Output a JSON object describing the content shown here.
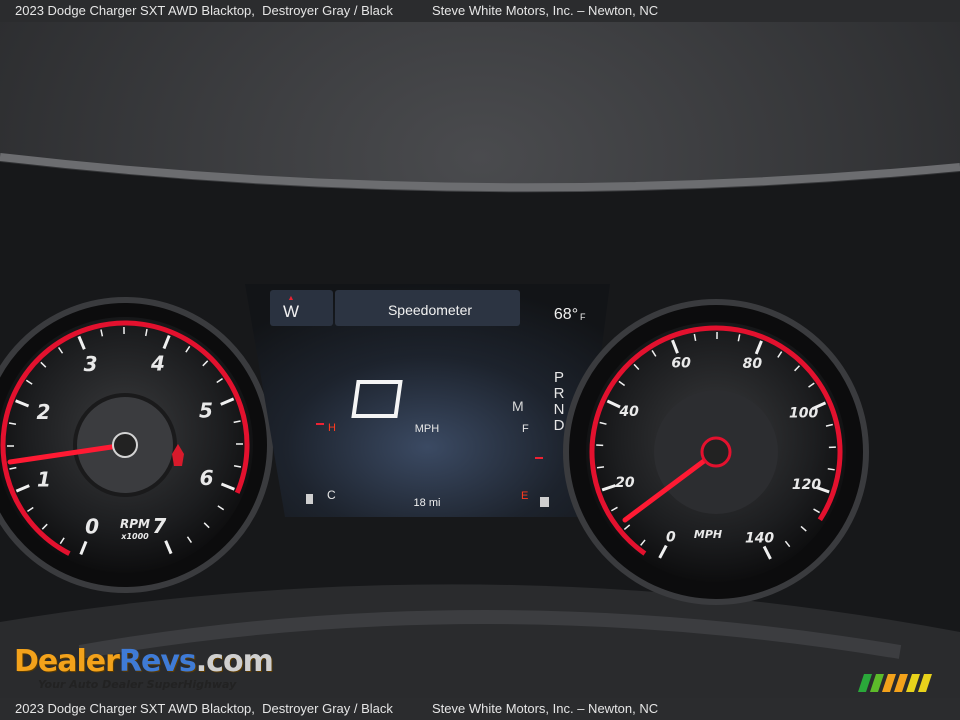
{
  "caption": {
    "vehicle": "2023 Dodge Charger SXT AWD Blacktop,",
    "color": "Destroyer Gray / Black",
    "dealer": "Steve White Motors, Inc. – Newton, NC"
  },
  "cluster": {
    "tachometer": {
      "ticks": [
        "0",
        "1",
        "2",
        "3",
        "4",
        "5",
        "6",
        "7"
      ],
      "unit": "RPM",
      "multiplier": "x1000",
      "needle_rpm": 1
    },
    "center_display": {
      "compass": "W",
      "title": "Speedometer",
      "temperature": "68°",
      "temp_unit": "F",
      "speed": "0",
      "speed_unit": "MPH",
      "gears": [
        "P",
        "R",
        "N",
        "D"
      ],
      "mode": "M",
      "odometer": "18 mi",
      "coolant_low": "C",
      "coolant_high": "H",
      "fuel_full": "F",
      "fuel_empty": "E"
    },
    "speedometer": {
      "ticks": [
        "0",
        "20",
        "40",
        "60",
        "80",
        "100",
        "120",
        "140"
      ],
      "unit": "MPH",
      "needle_mph": 0
    }
  },
  "watermark": {
    "brand_a": "Dealer",
    "brand_b": "Revs",
    "brand_c": ".com",
    "tagline": "Your Auto Dealer SuperHighway"
  }
}
